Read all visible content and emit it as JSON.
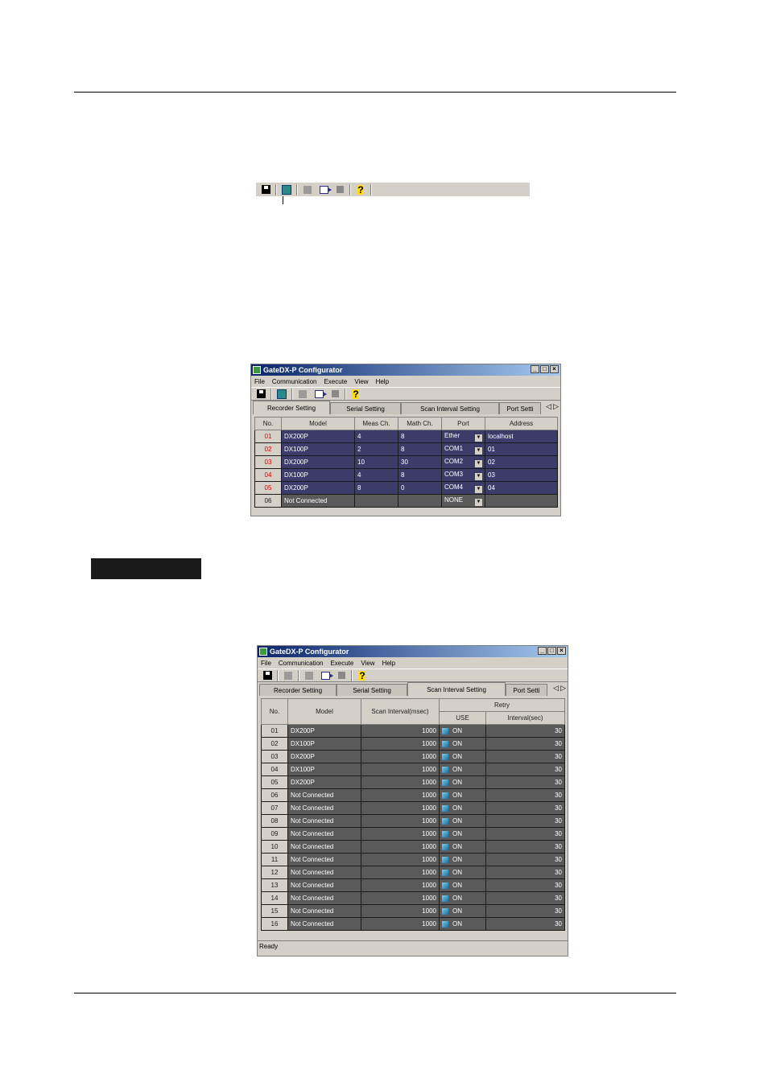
{
  "window_title": "GateDX-P Configurator",
  "menu": [
    "File",
    "Communication",
    "Execute",
    "View",
    "Help"
  ],
  "window_controls": [
    "_",
    "□",
    "×"
  ],
  "tab_arrows": [
    "◁",
    "▷"
  ],
  "tabs": [
    "Recorder Setting",
    "Serial Setting",
    "Scan Interval Setting",
    "Port Setti"
  ],
  "recorder_table": {
    "headers": [
      "No.",
      "Model",
      "Meas Ch.",
      "Math Ch.",
      "Port",
      "Address"
    ],
    "rows": [
      {
        "no": "01",
        "model": "DX200P",
        "meas": "4",
        "math": "8",
        "port": "Ether",
        "address": "localhost"
      },
      {
        "no": "02",
        "model": "DX100P",
        "meas": "2",
        "math": "8",
        "port": "COM1",
        "address": "01"
      },
      {
        "no": "03",
        "model": "DX200P",
        "meas": "10",
        "math": "30",
        "port": "COM2",
        "address": "02"
      },
      {
        "no": "04",
        "model": "DX100P",
        "meas": "4",
        "math": "8",
        "port": "COM3",
        "address": "03"
      },
      {
        "no": "05",
        "model": "DX200P",
        "meas": "8",
        "math": "0",
        "port": "COM4",
        "address": "04"
      },
      {
        "no": "06",
        "model": "Not Connected",
        "meas": "",
        "math": "",
        "port": "NONE",
        "address": ""
      }
    ]
  },
  "scan_table": {
    "headers": {
      "no": "No.",
      "model": "Model",
      "scan": "Scan Interval(msec)",
      "retry": "Retry",
      "use": "USE",
      "interval": "Interval(sec)"
    },
    "rows": [
      {
        "no": "01",
        "model": "DX200P",
        "scan": "1000",
        "use": "ON",
        "interval": "30"
      },
      {
        "no": "02",
        "model": "DX100P",
        "scan": "1000",
        "use": "ON",
        "interval": "30"
      },
      {
        "no": "03",
        "model": "DX200P",
        "scan": "1000",
        "use": "ON",
        "interval": "30"
      },
      {
        "no": "04",
        "model": "DX100P",
        "scan": "1000",
        "use": "ON",
        "interval": "30"
      },
      {
        "no": "05",
        "model": "DX200P",
        "scan": "1000",
        "use": "ON",
        "interval": "30"
      },
      {
        "no": "06",
        "model": "Not Connected",
        "scan": "1000",
        "use": "ON",
        "interval": "30"
      },
      {
        "no": "07",
        "model": "Not Connected",
        "scan": "1000",
        "use": "ON",
        "interval": "30"
      },
      {
        "no": "08",
        "model": "Not Connected",
        "scan": "1000",
        "use": "ON",
        "interval": "30"
      },
      {
        "no": "09",
        "model": "Not Connected",
        "scan": "1000",
        "use": "ON",
        "interval": "30"
      },
      {
        "no": "10",
        "model": "Not Connected",
        "scan": "1000",
        "use": "ON",
        "interval": "30"
      },
      {
        "no": "11",
        "model": "Not Connected",
        "scan": "1000",
        "use": "ON",
        "interval": "30"
      },
      {
        "no": "12",
        "model": "Not Connected",
        "scan": "1000",
        "use": "ON",
        "interval": "30"
      },
      {
        "no": "13",
        "model": "Not Connected",
        "scan": "1000",
        "use": "ON",
        "interval": "30"
      },
      {
        "no": "14",
        "model": "Not Connected",
        "scan": "1000",
        "use": "ON",
        "interval": "30"
      },
      {
        "no": "15",
        "model": "Not Connected",
        "scan": "1000",
        "use": "ON",
        "interval": "30"
      },
      {
        "no": "16",
        "model": "Not Connected",
        "scan": "1000",
        "use": "ON",
        "interval": "30"
      }
    ]
  },
  "status_text": "Ready"
}
